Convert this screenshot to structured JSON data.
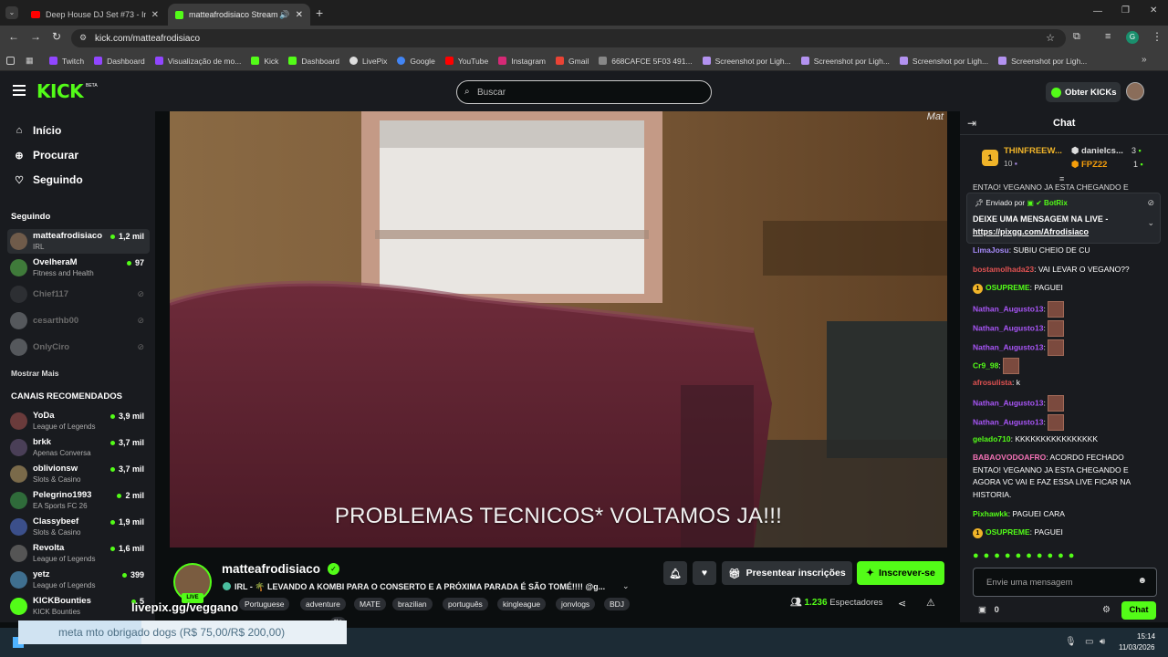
{
  "browser": {
    "tabs": [
      {
        "title": "Deep House DJ Set #73 - In The",
        "favicon": "youtube"
      },
      {
        "title": "matteafrodisiaco Stream - K",
        "favicon": "kick"
      }
    ],
    "url": "kick.com/matteafrodisiaco",
    "bookmarks": [
      "Twitch",
      "Dashboard",
      "Visualização de mo...",
      "Kick",
      "Dashboard",
      "LivePix",
      "Google",
      "YouTube",
      "Instagram",
      "Gmail",
      "668CAFCE 5F03 491...",
      "Screenshot por Ligh...",
      "Screenshot por Ligh...",
      "Screenshot por Ligh...",
      "Screenshot por Ligh..."
    ],
    "profile_initial": "G"
  },
  "header": {
    "logo": "KICK",
    "logo_badge": "BETA",
    "search_placeholder": "Buscar",
    "get_kicks_label": "Obter KICKs"
  },
  "sidebar": {
    "nav": [
      {
        "label": "Início",
        "icon": "home-icon"
      },
      {
        "label": "Procurar",
        "icon": "compass-icon"
      },
      {
        "label": "Seguindo",
        "icon": "heart-icon"
      }
    ],
    "following_title": "Seguindo",
    "following": [
      {
        "name": "matteafrodisiaco",
        "category": "IRL",
        "viewers": "1,2 mil",
        "live": true
      },
      {
        "name": "OvelheraM",
        "category": "Fitness and Health",
        "viewers": "97",
        "live": true
      },
      {
        "name": "Chief117",
        "live": false
      },
      {
        "name": "cesarthb00",
        "live": false
      },
      {
        "name": "OnlyCiro",
        "live": false
      }
    ],
    "show_more": "Mostrar Mais",
    "recommended_title": "CANAIS RECOMENDADOS",
    "recommended": [
      {
        "name": "YoDa",
        "category": "League of Legends",
        "viewers": "3,9 mil"
      },
      {
        "name": "brkk",
        "category": "Apenas Conversa",
        "viewers": "3,7 mil"
      },
      {
        "name": "oblivionsw",
        "category": "Slots & Casino",
        "viewers": "3,7 mil"
      },
      {
        "name": "Pelegrino1993",
        "category": "EA Sports FC 26",
        "viewers": "2 mil"
      },
      {
        "name": "Classybeef",
        "category": "Slots & Casino",
        "viewers": "1,9 mil"
      },
      {
        "name": "Revolta",
        "category": "League of Legends",
        "viewers": "1,6 mil"
      },
      {
        "name": "yetz",
        "category": "League of Legends",
        "viewers": "399"
      },
      {
        "name": "KICKBounties",
        "category": "KICK Bounties",
        "viewers": "5"
      }
    ]
  },
  "video": {
    "caption": "PROBLEMAS TECNICOS* VOLTAMOS JA!!!",
    "watermark": "Mat"
  },
  "stream": {
    "channel": "matteafrodisiaco",
    "live_badge": "LIVE",
    "title": "IRL - 🌴 LEVANDO A KOMBI PARA O CONSERTO E A PRÓXIMA PARADA É SÃO TOMÉ!!!! @g...",
    "tags": [
      "Portuguese",
      "adventure",
      "MATE",
      "brazilian",
      "português",
      "kingleague",
      "jonvlogs",
      "BDJ"
    ],
    "tags_row2": "tte",
    "viewers": "1.236",
    "viewers_label": "Espectadores",
    "gift_label": "Presentear inscrições",
    "subscribe_label": "Inscrever-se",
    "overlay_link": "livepix.gg/veggano"
  },
  "chat": {
    "title": "Chat",
    "leaderboard": {
      "first": {
        "rank": "1",
        "name": "THINFREEW...",
        "value": "10"
      },
      "others": [
        {
          "name": "danielcs...",
          "value": "3"
        },
        {
          "name": "FPZ22",
          "value": "1"
        }
      ]
    },
    "truncated_top": "ENTAO! VEGANNO JA ESTA CHEGANDO E",
    "pinned": {
      "sent_by": "Enviado por",
      "bot": "BotRix",
      "line1": "DEIXE UMA MENSAGEM NA LIVE -",
      "link": "https://pixgg.com/Afrodisiaco"
    },
    "messages": [
      {
        "user": "LimaJosu",
        "text": "SUBIU CHEIO DE CU",
        "color": "#a78bfa"
      },
      {
        "user": "bostamolhada23",
        "text": "VAI LEVAR O VEGANO??",
        "color": "#e05252"
      },
      {
        "user": "OSUPREME",
        "text": "PAGUEI",
        "color": "#53fc18",
        "badge": "1"
      },
      {
        "user": "Nathan_Augusto13",
        "text": "",
        "color": "#a855f7",
        "emote": true
      },
      {
        "user": "Nathan_Augusto13",
        "text": "",
        "color": "#a855f7",
        "emote": true
      },
      {
        "user": "Nathan_Augusto13",
        "text": "",
        "color": "#a855f7",
        "emote": true
      },
      {
        "user": "Cr9_98",
        "text": "",
        "color": "#53fc18",
        "emote": true
      },
      {
        "user": "afrosulista",
        "text": "k",
        "color": "#e05252"
      },
      {
        "user": "Nathan_Augusto13",
        "text": "",
        "color": "#a855f7",
        "emote": true
      },
      {
        "user": "Nathan_Augusto13",
        "text": "",
        "color": "#a855f7",
        "emote": true
      },
      {
        "user": "gelado710",
        "text": "KKKKKKKKKKKKKKKK",
        "color": "#53fc18"
      },
      {
        "user": "BABAOVODOAFRO",
        "text": "ACORDO FECHADO ENTAO! VEGANNO JA ESTA CHEGANDO E AGORA VC VAI E FAZ ESSA LIVE FICAR NA HISTORIA.",
        "color": "#f472b6"
      },
      {
        "user": "Pixhawkk",
        "text": "PAGUEI CARA",
        "color": "#53fc18"
      },
      {
        "user": "OSUPREME",
        "text": "PAGUEI",
        "color": "#53fc18",
        "badge": "1"
      }
    ],
    "input_placeholder": "Envie uma mensagem",
    "points": "0",
    "send_label": "Chat"
  },
  "overlay": {
    "donation_text": "meta mto obrigado dogs (R$ 75,00/R$ 200,00)",
    "donation_progress": 0.375
  },
  "taskbar": {
    "time": "15:14",
    "date": "11/03/2026"
  },
  "colors": {
    "accent": "#53fc18",
    "background": "#0b0e0f",
    "panel": "#191b1f"
  }
}
